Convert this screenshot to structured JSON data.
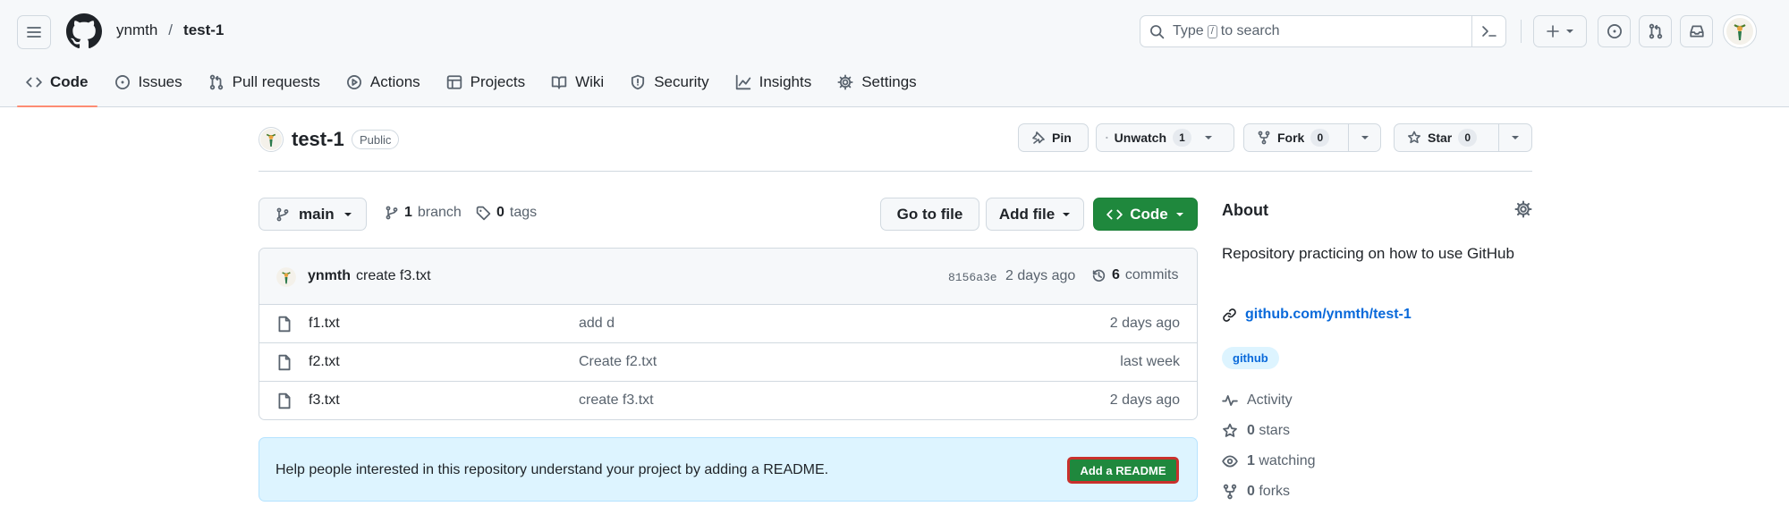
{
  "header": {
    "owner": "ynmth",
    "separator": "/",
    "repo": "test-1",
    "search": {
      "prefix": "Type",
      "key": "/",
      "suffix": "to search"
    }
  },
  "tabs": [
    {
      "label": "Code",
      "icon": "code-icon",
      "active": true
    },
    {
      "label": "Issues",
      "icon": "issue-opened-icon"
    },
    {
      "label": "Pull requests",
      "icon": "git-pull-request-icon"
    },
    {
      "label": "Actions",
      "icon": "play-icon"
    },
    {
      "label": "Projects",
      "icon": "table-icon"
    },
    {
      "label": "Wiki",
      "icon": "book-icon"
    },
    {
      "label": "Security",
      "icon": "shield-icon"
    },
    {
      "label": "Insights",
      "icon": "graph-icon"
    },
    {
      "label": "Settings",
      "icon": "gear-icon"
    }
  ],
  "repo": {
    "name": "test-1",
    "visibility": "Public",
    "pin_label": "Pin",
    "watch_label": "Unwatch",
    "watch_count": "1",
    "fork_label": "Fork",
    "fork_count": "0",
    "star_label": "Star",
    "star_count": "0"
  },
  "controls": {
    "branch": "main",
    "branch_count": "1",
    "branch_word": "branch",
    "tag_count": "0",
    "tag_word": "tags",
    "goto_file": "Go to file",
    "add_file": "Add file",
    "code_button": "Code"
  },
  "latest_commit": {
    "author": "ynmth",
    "message": "create f3.txt",
    "sha": "8156a3e",
    "age": "2 days ago",
    "commit_count": "6",
    "commit_word": "commits"
  },
  "files": [
    {
      "name": "f1.txt",
      "message": "add d",
      "date": "2 days ago"
    },
    {
      "name": "f2.txt",
      "message": "Create f2.txt",
      "date": "last week"
    },
    {
      "name": "f3.txt",
      "message": "create f3.txt",
      "date": "2 days ago"
    }
  ],
  "readme_banner": {
    "text": "Help people interested in this repository understand your project by adding a README.",
    "button": "Add a README"
  },
  "about": {
    "title": "About",
    "description": "Repository practicing on how to use GitHub",
    "link": "github.com/ynmth/test-1",
    "topic": "github",
    "activity": "Activity",
    "stars_count": "0",
    "stars_word": "stars",
    "watching_count": "1",
    "watching_word": "watching",
    "forks_count": "0",
    "forks_word": "forks"
  },
  "colors": {
    "primary_green": "#1f883d",
    "link_blue": "#0969da",
    "tab_underline": "#fd8c73",
    "readme_bg": "#ddf4ff",
    "highlight_outline": "#c9302c"
  }
}
